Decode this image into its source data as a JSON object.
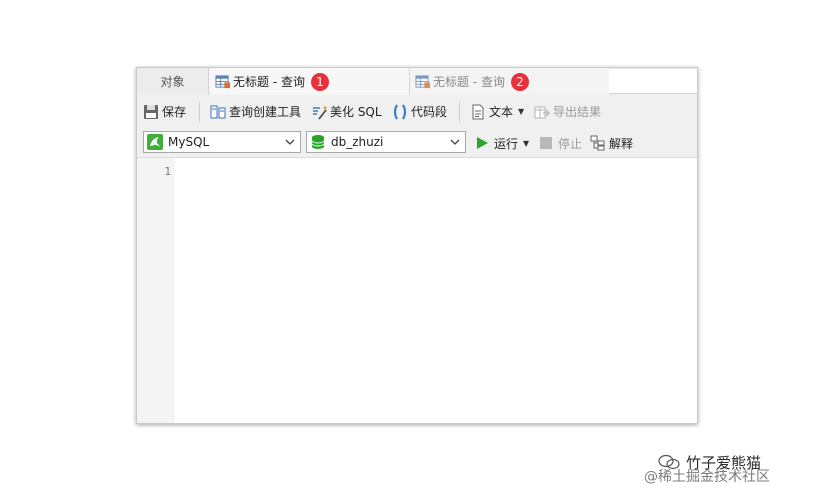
{
  "tabs": {
    "objects_label": "对象",
    "query1": {
      "label": "无标题 - 查询",
      "badge": "1"
    },
    "query2": {
      "label": "无标题 - 查询",
      "badge": "2"
    }
  },
  "toolbar": {
    "save": "保存",
    "query_builder": "查询创建工具",
    "beautify_sql": "美化 SQL",
    "code_snippet": "代码段",
    "text": "文本",
    "export_result": "导出结果"
  },
  "connection": {
    "selected": "MySQL",
    "icon": "mysql-dolphin-icon",
    "accent": "#3fae3b"
  },
  "database": {
    "selected": "db_zhuzi",
    "icon": "database-icon",
    "accent": "#26a626"
  },
  "run": {
    "run_label": "运行",
    "stop_label": "停止",
    "explain_label": "解释",
    "run_color": "#2fa32f"
  },
  "editor": {
    "line_numbers": [
      "1"
    ]
  },
  "watermark": {
    "name": "竹子爱熊猫",
    "site": "@稀土掘金技术社区"
  },
  "badge_color": "#e8323a"
}
